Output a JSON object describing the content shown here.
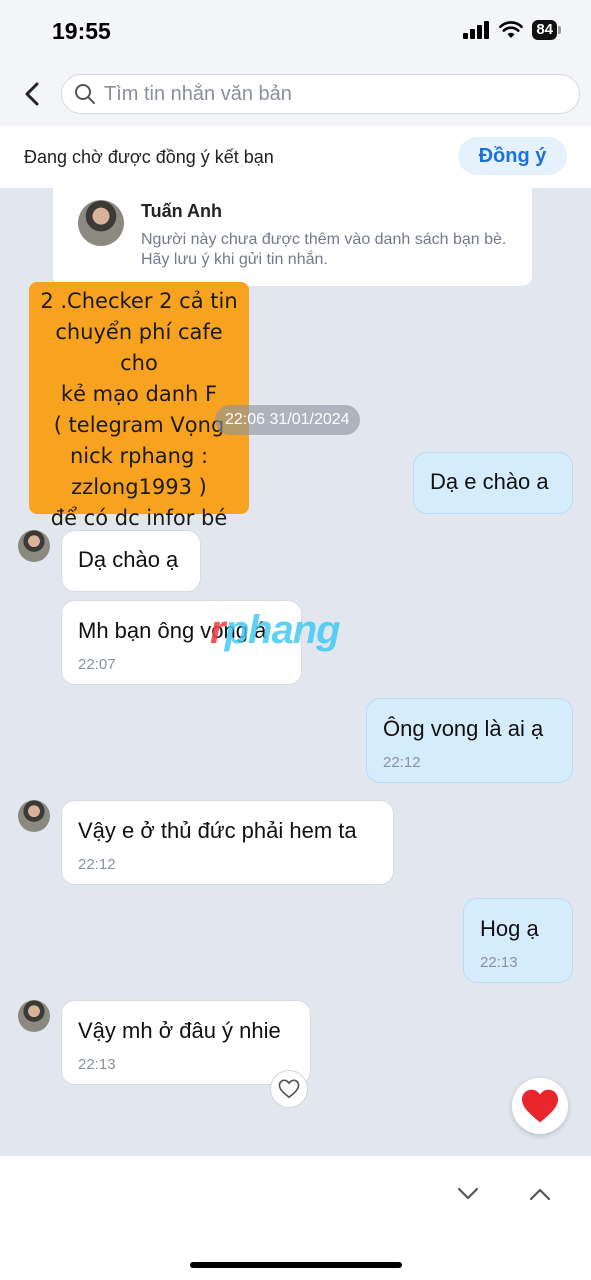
{
  "status_bar": {
    "time": "19:55",
    "battery": "84"
  },
  "search": {
    "placeholder": "Tìm tin nhắn văn bản"
  },
  "friend_request": {
    "text": "Đang chờ được đồng ý kết bạn",
    "accept_label": "Đồng ý"
  },
  "notice": {
    "name": "Tuấn Anh",
    "text": "Người này chưa được thêm vào danh sách bạn bè. Hãy lưu ý khi gửi tin nhắn."
  },
  "sticker_lines": [
    "2 .Checker 2 cả tin",
    "chuyển phí cafe cho",
    "kẻ mạo danh F",
    "( telegram Vọng",
    "nick rphang :",
    "zzlong1993 )",
    "để có dc infor bé"
  ],
  "date_separator": "22:06 31/01/2024",
  "messages": [
    {
      "direction": "out",
      "text": "Dạ e chào a",
      "time": ""
    },
    {
      "direction": "in",
      "text": "Dạ chào ạ",
      "time": ""
    },
    {
      "direction": "in",
      "text": "Mh bạn ông vong á",
      "time": "22:07"
    },
    {
      "direction": "out",
      "text": "Ông vong là ai ạ",
      "time": "22:12"
    },
    {
      "direction": "in",
      "text": "Vậy e ở thủ đức phải hem ta",
      "time": "22:12"
    },
    {
      "direction": "out",
      "text": "Hog ạ",
      "time": "22:13"
    },
    {
      "direction": "in",
      "text": "Vậy mh ở đâu ý nhie",
      "time": "22:13"
    }
  ],
  "watermark": {
    "first": "r",
    "rest": "phang"
  },
  "colors": {
    "accent": "#1a73d9",
    "outgoing_bubble": "#d5ecfd",
    "sticker": "#f7a31f",
    "heart": "#e8262c"
  }
}
